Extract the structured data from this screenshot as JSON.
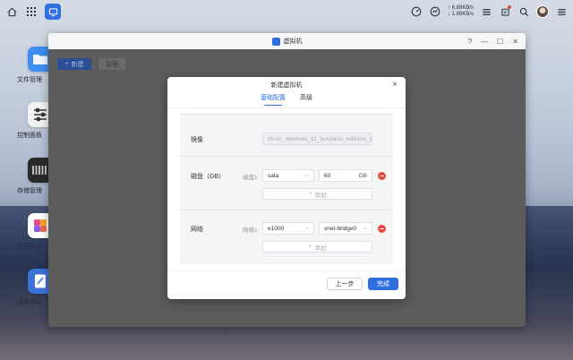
{
  "taskbar": {
    "net_up": "↑ 6.88KB/s",
    "net_down": "↓ 1.88KB/s"
  },
  "desktop": {
    "icons": [
      {
        "label": "文件管理",
        "icon": "folder-icon",
        "color": "#3d8ef0"
      },
      {
        "label": "控制面板",
        "icon": "sliders-icon",
        "color": "#f2f2f2"
      },
      {
        "label": "存储管理",
        "icon": "storage-icon",
        "color": "#2a2a2a"
      },
      {
        "label": "应用中心",
        "icon": "app-center-icon",
        "color": "#ffffff"
      },
      {
        "label": "日志中心",
        "icon": "log-icon",
        "color": "#3a72d8"
      }
    ]
  },
  "window": {
    "title": "虚拟机",
    "toolbar": {
      "new_label": "新建",
      "manage_label": "管理"
    }
  },
  "dialog": {
    "title": "新建虚拟机",
    "tabs": [
      {
        "label": "基础配置",
        "active": true
      },
      {
        "label": "高级",
        "active": false
      }
    ],
    "image": {
      "label": "镜像",
      "value": "zh-cn_windows_11_business_editions_v"
    },
    "disk": {
      "label": "磁盘（GB）",
      "sub_label": "磁盘1",
      "type": "sata",
      "size": "60",
      "unit": "GB",
      "add_label": "添加"
    },
    "network": {
      "label": "网络",
      "sub_label": "网络1",
      "adapter": "e1000",
      "bridge": "vnet-bridge0",
      "add_label": "添加"
    },
    "footer": {
      "prev_label": "上一步",
      "done_label": "完成"
    }
  },
  "colors": {
    "accent": "#2f6fe0",
    "danger": "#e64a3b"
  }
}
